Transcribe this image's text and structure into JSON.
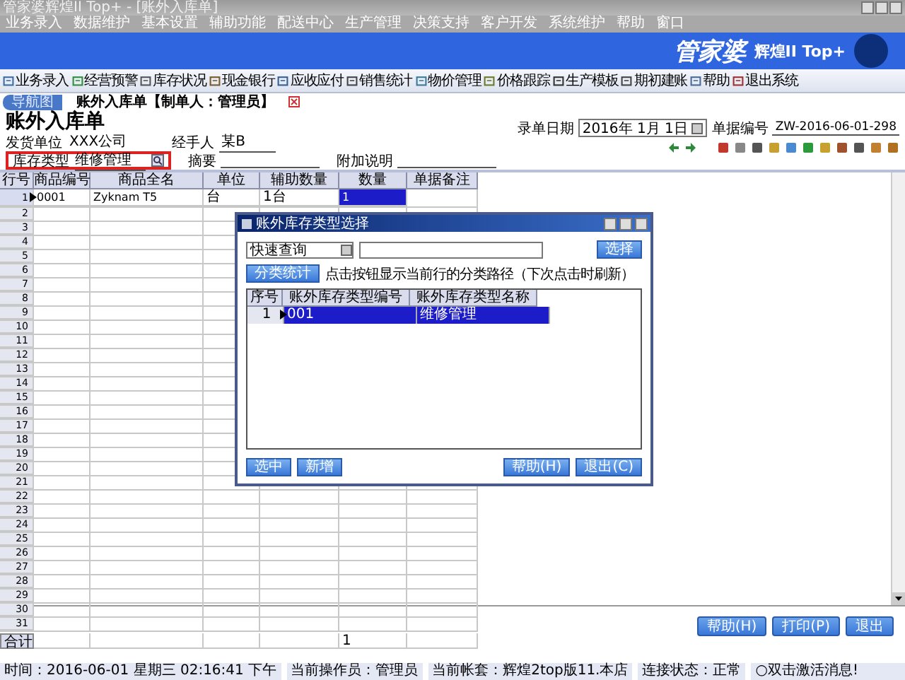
{
  "window": {
    "title": "管家婆辉煌II Top+ - [账外入库单]"
  },
  "menu": [
    "业务录入",
    "数据维护",
    "基本设置",
    "辅助功能",
    "配送中心",
    "生产管理",
    "决策支持",
    "客户开发",
    "系统维护",
    "帮助",
    "窗口"
  ],
  "banner": {
    "logo": "管家婆",
    "edition": "辉煌II Top+"
  },
  "toolbar": [
    "业务录入",
    "经营预警",
    "库存状况",
    "现金银行",
    "应收应付",
    "销售统计",
    "物价管理",
    "价格跟踪",
    "生产模板",
    "期初建账",
    "帮助",
    "退出系统"
  ],
  "tabs": [
    {
      "label": "导航图",
      "selected": false
    },
    {
      "label": "账外入库单【制单人：管理员】",
      "selected": true
    }
  ],
  "form": {
    "title": "账外入库单",
    "date_label": "录单日期",
    "date": "2016年 1月 1日",
    "number_label": "单据编号",
    "number": "ZW-2016-06-01-298",
    "supplier_label": "发货单位",
    "supplier": "XXX公司",
    "handler_label": "经手人",
    "handler": "某B",
    "stock_type_label": "库存类型",
    "stock_type": "维修管理",
    "summary_label": "摘要",
    "note_label": "附加说明"
  },
  "grid": {
    "columns": [
      "行号",
      "商品编号",
      "商品全名",
      "单位",
      "辅助数量",
      "数量",
      "单据备注"
    ],
    "rows": [
      {
        "number": "1",
        "code": "0001",
        "name": "Zyknam T5",
        "unit": "台",
        "aux_qty": "1台",
        "qty": "1",
        "selected": true
      },
      {
        "number": "2",
        "selected": false
      },
      {
        "number": "3",
        "selected": false
      },
      {
        "number": "4",
        "selected": false
      },
      {
        "number": "5",
        "selected": false
      },
      {
        "number": "6",
        "selected": false
      },
      {
        "number": "7",
        "selected": false
      },
      {
        "number": "8",
        "selected": false
      },
      {
        "number": "9",
        "selected": false
      },
      {
        "number": "10",
        "selected": false
      },
      {
        "number": "11",
        "selected": false
      },
      {
        "number": "12",
        "selected": false
      },
      {
        "number": "13",
        "selected": false
      },
      {
        "number": "14",
        "selected": false
      },
      {
        "number": "15",
        "selected": false
      },
      {
        "number": "16",
        "selected": false
      },
      {
        "number": "17",
        "selected": false
      },
      {
        "number": "18",
        "selected": false
      },
      {
        "number": "19",
        "selected": false
      },
      {
        "number": "20",
        "selected": false
      },
      {
        "number": "21",
        "selected": false
      },
      {
        "number": "22",
        "selected": false
      },
      {
        "number": "23",
        "selected": false
      },
      {
        "number": "24",
        "selected": false
      },
      {
        "number": "25",
        "selected": false
      },
      {
        "number": "26",
        "selected": false
      },
      {
        "number": "27",
        "selected": false
      },
      {
        "number": "28",
        "selected": false
      },
      {
        "number": "29",
        "selected": false
      },
      {
        "number": "30",
        "selected": false
      },
      {
        "number": "31",
        "selected": false
      }
    ],
    "total": {
      "label": "合计",
      "qty": "1"
    }
  },
  "dialog": {
    "title": "账外库存类型选择",
    "search_mode": "快速查询",
    "search_button": "选择",
    "category_button": "分类统计",
    "hint": "点击按钮显示当前行的分类路径（下次点击时刷新）",
    "columns": [
      "序号",
      "账外库存类型编号",
      "账外库存类型名称"
    ],
    "rows": [
      {
        "number": "1",
        "code": "001",
        "name": "维修管理",
        "selected": true
      }
    ],
    "left_buttons": [
      "选中",
      "新增"
    ],
    "right_buttons": [
      "帮助(H)",
      "退出(C)"
    ]
  },
  "footer_buttons": [
    "帮助(H)",
    "打印(P)",
    "退出"
  ],
  "status_bar": [
    "时间：2016-06-01 星期三 02:16:41 下午",
    "当前操作员：管理员",
    "当前帐套：辉煌2top版11.本店",
    "连接状态：正常",
    "○双击激活消息!"
  ]
}
